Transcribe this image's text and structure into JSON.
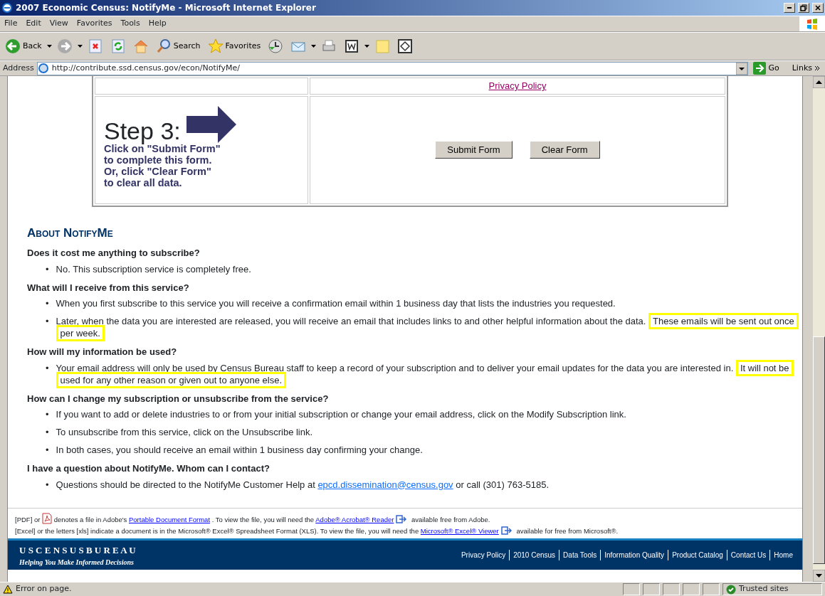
{
  "window": {
    "title": "2007 Economic Census: NotifyMe - Microsoft Internet Explorer"
  },
  "menu": [
    "File",
    "Edit",
    "View",
    "Favorites",
    "Tools",
    "Help"
  ],
  "toolbar": [
    {
      "kind": "back",
      "label": "Back"
    },
    {
      "kind": "forward"
    },
    {
      "kind": "stop"
    },
    {
      "kind": "refresh"
    },
    {
      "kind": "home"
    },
    {
      "kind": "search",
      "label": "Search"
    },
    {
      "kind": "favorites",
      "label": "Favorites"
    },
    {
      "kind": "history"
    },
    {
      "kind": "mail"
    },
    {
      "kind": "print"
    },
    {
      "kind": "word"
    },
    {
      "kind": "note"
    },
    {
      "kind": "diamond"
    }
  ],
  "address": {
    "label": "Address",
    "url": "http://contribute.ssd.census.gov/econ/NotifyMe/",
    "go": "Go",
    "links": "Links"
  },
  "form": {
    "privacy_link": "Privacy Policy",
    "step_title": "Step 3:",
    "instruction_lines": [
      "Click on \"Submit Form\"",
      "to complete this form.",
      "Or, click \"Clear Form\"",
      "to clear all data."
    ],
    "buttons": [
      "Submit Form",
      "Clear Form"
    ]
  },
  "about": {
    "title": "About NotifyMe",
    "faq": [
      {
        "question": "Does it cost me anything to subscribe?",
        "answers": [
          {
            "bullet": "•",
            "segments": [
              {
                "text": "No. This subscription service is completely free.",
                "highlighted": false
              }
            ]
          }
        ]
      },
      {
        "question": "What will I receive from this service?",
        "answers": [
          {
            "bullet": "•",
            "segments": [
              {
                "text": "When you first subscribe to this service you will receive a confirmation email within 1 business day that lists the industries you requested.",
                "highlighted": false
              }
            ]
          },
          {
            "bullet": "•",
            "segments": [
              {
                "text": "Later, when the data you are interested are released, you will receive an email that includes links to and other helpful information about the data.",
                "highlighted": false
              },
              {
                "text": "These emails will be sent out once",
                "highlighted": true
              },
              {
                "text": "per week.",
                "highlighted": true
              }
            ]
          }
        ]
      },
      {
        "question": "How will my information be used?",
        "answers": [
          {
            "bullet": "•",
            "segments": [
              {
                "text": "Your email address will only be used by Census Bureau staff to keep a record of your subscription and to deliver your email updates for the data you are interested in.",
                "highlighted": false
              },
              {
                "text": "It will not be",
                "highlighted": true
              },
              {
                "text": "used for any other reason or given out to anyone else.",
                "highlighted": true
              }
            ]
          }
        ]
      },
      {
        "question": "How can I change my subscription or unsubscribe from the service?",
        "answers": [
          {
            "bullet": "•",
            "segments": [
              {
                "text": "If you want to add or delete industries to or from your initial subscription or change your email address, click on the Modify Subscription link.",
                "highlighted": false
              }
            ]
          },
          {
            "bullet": "•",
            "segments": [
              {
                "text": "To unsubscribe from this service, click on the Unsubscribe link.",
                "highlighted": false
              }
            ]
          },
          {
            "bullet": "•",
            "segments": [
              {
                "text": "In both cases, you should receive an email within 1 business day confirming your change.",
                "highlighted": false
              }
            ]
          }
        ]
      },
      {
        "question": "I have a question about NotifyMe. Whom can I contact?",
        "answers": [
          {
            "bullet": "•",
            "segments": [
              {
                "text": "Questions should be directed to the NotifyMe Customer Help at",
                "highlighted": false
              },
              {
                "kind": "link",
                "text": "epcd.dissemination@census.gov"
              },
              {
                "text": "or call (301) 763-5185.",
                "highlighted": false
              }
            ]
          }
        ]
      }
    ]
  },
  "notes": [
    [
      {
        "kind": "text",
        "text": "[PDF] or"
      },
      {
        "kind": "pdf_icon"
      },
      {
        "kind": "text",
        "text": "denotes a file in Adobe's"
      },
      {
        "kind": "link",
        "text": "Portable Document Format"
      },
      {
        "kind": "text",
        "text": ". To view the file, you will need the"
      },
      {
        "kind": "link",
        "text": "Adobe® Acrobat® Reader"
      },
      {
        "kind": "external_icon"
      },
      {
        "kind": "text",
        "text": "available free from Adobe."
      }
    ],
    [
      {
        "kind": "text",
        "text": "[Excel] or the letters [xls] indicate a document is in the Microsoft® Excel® Spreadsheet Format (XLS). To view the file, you will need the"
      },
      {
        "kind": "link",
        "text": "Microsoft® Excel® Viewer"
      },
      {
        "kind": "external_icon"
      },
      {
        "kind": "text",
        "text": "available for free from Microsoft®."
      }
    ]
  ],
  "footer": {
    "logo": "U S C E N S U S B U R E A U",
    "tagline": "Helping You Make Informed Decisions",
    "links": [
      "Privacy Policy",
      "2010 Census",
      "Data Tools",
      "Information Quality",
      "Product Catalog",
      "Contact Us",
      "Home"
    ]
  },
  "status_bar": {
    "text": "Error on page.",
    "zone": "Trusted sites"
  }
}
